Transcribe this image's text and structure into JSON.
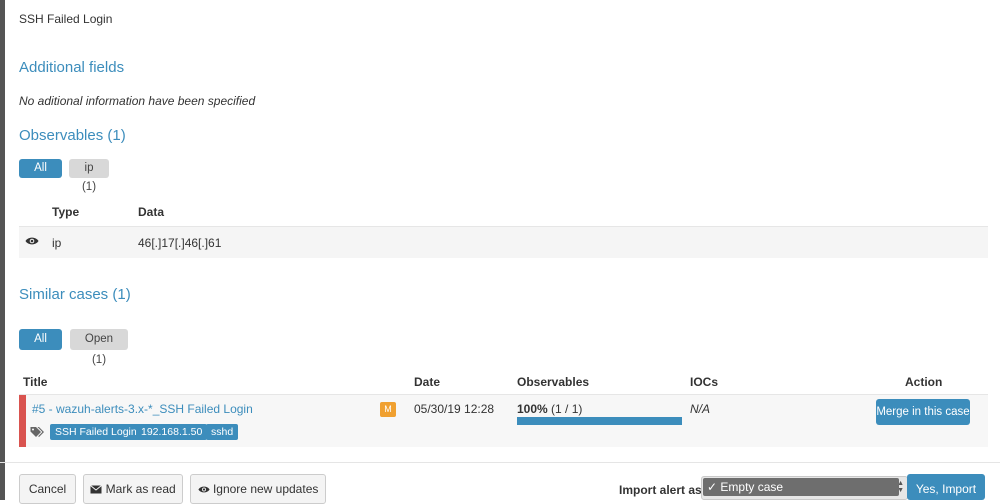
{
  "description": "SSH Failed Login",
  "additional_fields": {
    "title": "Additional fields",
    "empty_text": "No aditional information have been specified"
  },
  "observables": {
    "title": "Observables (1)",
    "filters": [
      "All (1)",
      "ip (1)"
    ],
    "columns": {
      "type": "Type",
      "data": "Data"
    },
    "rows": [
      {
        "type": "ip",
        "data": "46[.]17[.]46[.]61"
      }
    ]
  },
  "similar_cases": {
    "title": "Similar cases (1)",
    "filters": [
      "All (1)",
      "Open (1)"
    ],
    "columns": {
      "title": "Title",
      "date": "Date",
      "observables": "Observables",
      "iocs": "IOCs",
      "action": "Action"
    },
    "rows": [
      {
        "title": "#5 - wazuh-alerts-3.x-*_SSH Failed Login",
        "tags": [
          "SSH Failed Login",
          "192.168.1.50",
          "sshd"
        ],
        "severity": "M",
        "date": "05/30/19 12:28",
        "observables_pct": "100%",
        "observables_count": "(1 / 1)",
        "observables_fraction": 1.0,
        "iocs": "N/A",
        "action": "Merge in this case"
      }
    ]
  },
  "footer": {
    "cancel": "Cancel",
    "mark_read": "Mark as read",
    "ignore_updates": "Ignore new updates",
    "import_label": "Import alert as",
    "import_option": "✓ Empty case",
    "import_button": "Yes, Import"
  },
  "colors": {
    "accent": "#3c8dbc",
    "severity_medium": "#f0a030",
    "danger": "#d9534f"
  }
}
